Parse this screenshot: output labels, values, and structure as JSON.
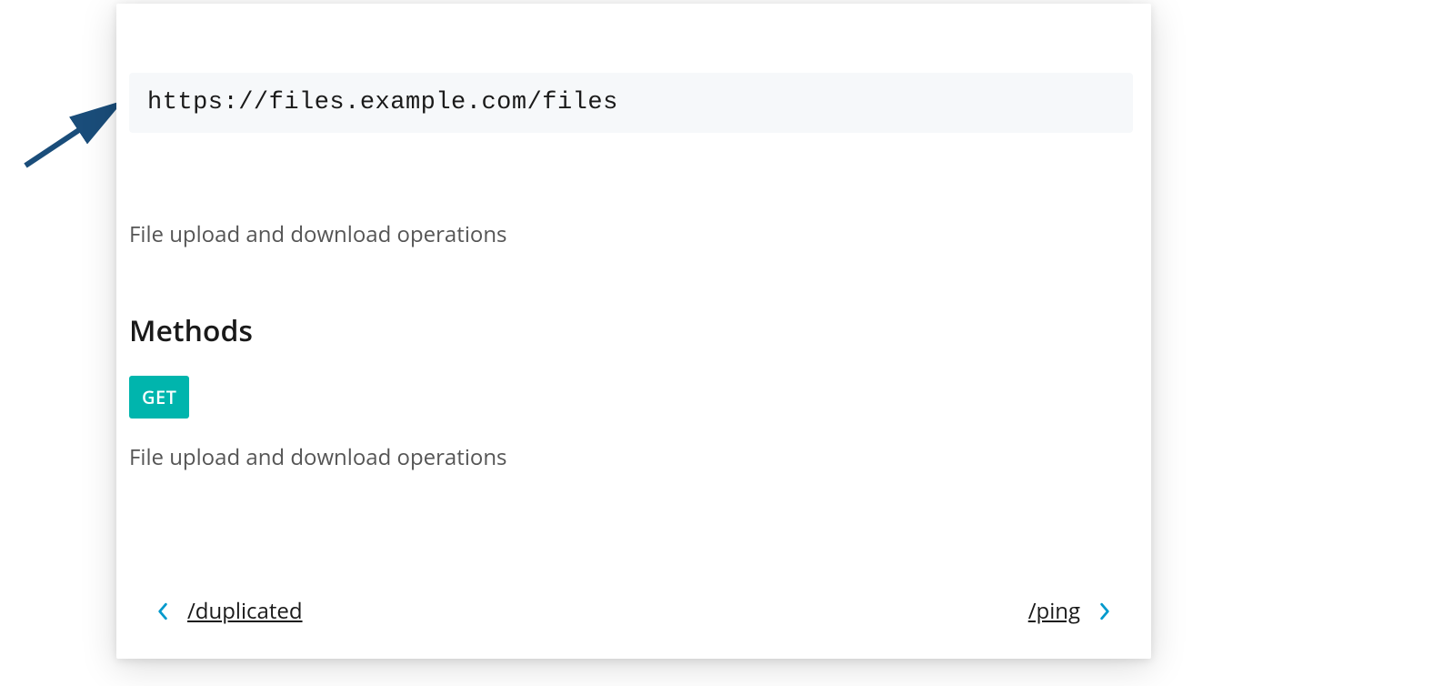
{
  "url": "https://files.example.com/files",
  "description": "File upload and download operations",
  "methods_heading": "Methods",
  "methods": [
    {
      "verb": "GET",
      "description": "File upload and download operations"
    }
  ],
  "nav": {
    "prev": {
      "label": "/duplicated"
    },
    "next": {
      "label": "/ping"
    }
  },
  "colors": {
    "badge_bg": "#00b5ad",
    "chevron": "#0099cc",
    "arrow": "#1a4d7a"
  }
}
